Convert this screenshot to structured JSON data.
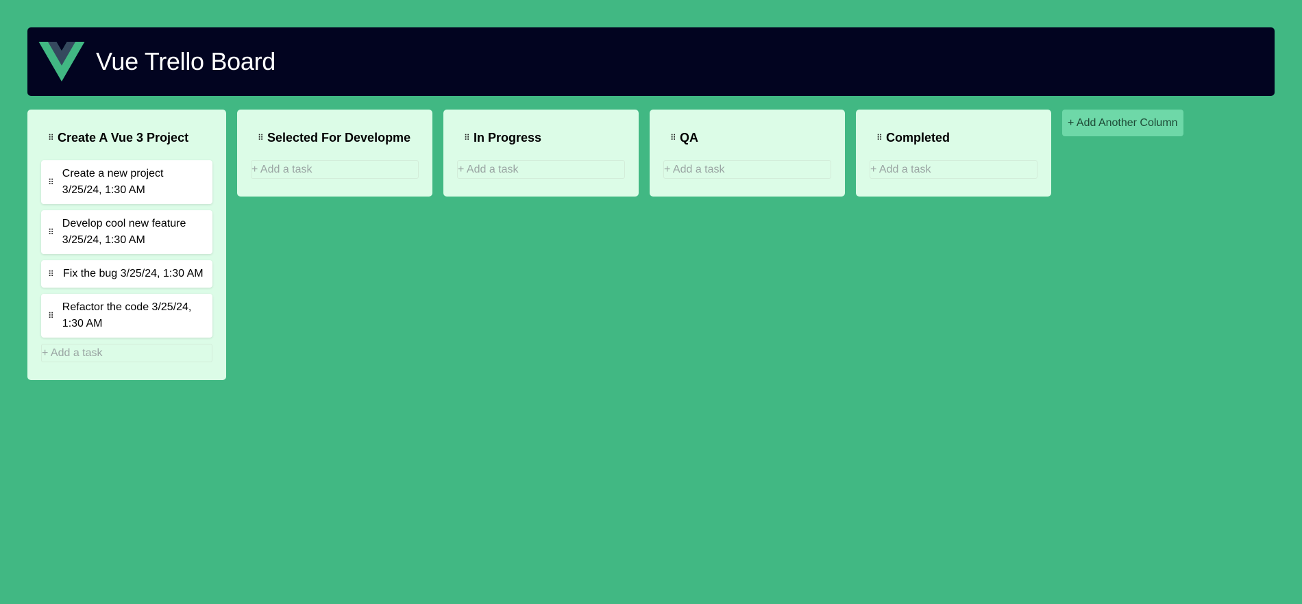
{
  "header": {
    "title": "Vue Trello Board",
    "logo_icon": "vue-logo-icon",
    "colors": {
      "bg": "#020420",
      "logo_outer": "#41b883",
      "logo_inner": "#35495e"
    }
  },
  "board": {
    "background": "#41b883",
    "drag_handle_glyph": "⠿",
    "add_task_placeholder": "+ Add a task",
    "add_column_label": "+ Add Another Column",
    "columns": [
      {
        "title": "Create A Vue 3 Project",
        "tasks": [
          {
            "title": "Create a new project",
            "created": "3/25/24, 1:30 AM"
          },
          {
            "title": "Develop cool new feature",
            "created": "3/25/24, 1:30 AM"
          },
          {
            "title": "Fix the bug",
            "created": "3/25/24, 1:30 AM"
          },
          {
            "title": "Refactor the code",
            "created": "3/25/24, 1:30 AM"
          }
        ]
      },
      {
        "title": "Selected For Development",
        "tasks": []
      },
      {
        "title": "In Progress",
        "tasks": []
      },
      {
        "title": "QA",
        "tasks": []
      },
      {
        "title": "Completed",
        "tasks": []
      }
    ]
  }
}
